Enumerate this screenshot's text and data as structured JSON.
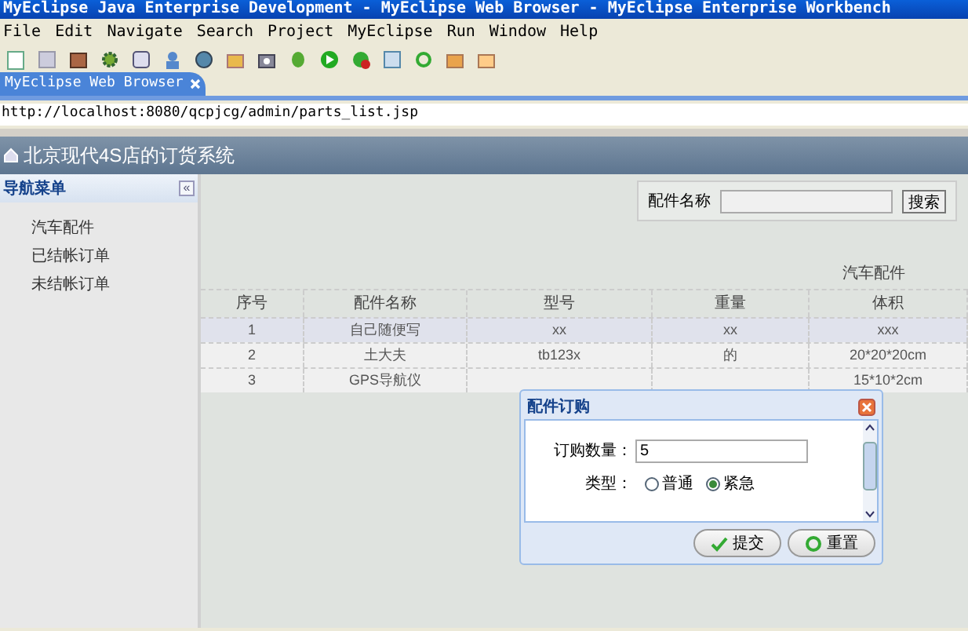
{
  "window": {
    "title": "MyEclipse Java Enterprise Development - MyEclipse Web Browser - MyEclipse Enterprise Workbench"
  },
  "menu": [
    "File",
    "Edit",
    "Navigate",
    "Search",
    "Project",
    "MyEclipse",
    "Run",
    "Window",
    "Help"
  ],
  "editor_tab": {
    "label": "MyEclipse Web Browser",
    "selected": true
  },
  "address": "http://localhost:8080/qcpjcg/admin/parts_list.jsp",
  "app": {
    "title": "北京现代4S店的订货系统",
    "sidebar": {
      "title": "导航菜单",
      "collapse": "«",
      "items": [
        "汽车配件",
        "已结帐订单",
        "未结帐订单"
      ]
    },
    "search": {
      "label": "配件名称",
      "button": "搜索"
    },
    "table": {
      "caption": "汽车配件",
      "columns": [
        "序号",
        "配件名称",
        "型号",
        "重量",
        "体积"
      ],
      "rows": [
        {
          "cells": [
            "1",
            "自己随便写",
            "xx",
            "xx",
            "xxx"
          ],
          "selected": true
        },
        {
          "cells": [
            "2",
            "土大夫",
            "tb123x",
            "的",
            "20*20*20cm"
          ],
          "selected": false
        },
        {
          "cells": [
            "3",
            "GPS导航仪",
            "",
            "",
            "15*10*2cm"
          ],
          "selected": false
        }
      ]
    }
  },
  "dialog": {
    "title": "配件订购",
    "quantity_label": "订购数量：",
    "quantity": "5",
    "type_label": "类型：",
    "options": [
      {
        "label": "普通",
        "selected": false
      },
      {
        "label": "紧急",
        "selected": true
      }
    ],
    "buttons": [
      "提交",
      "重置"
    ]
  }
}
